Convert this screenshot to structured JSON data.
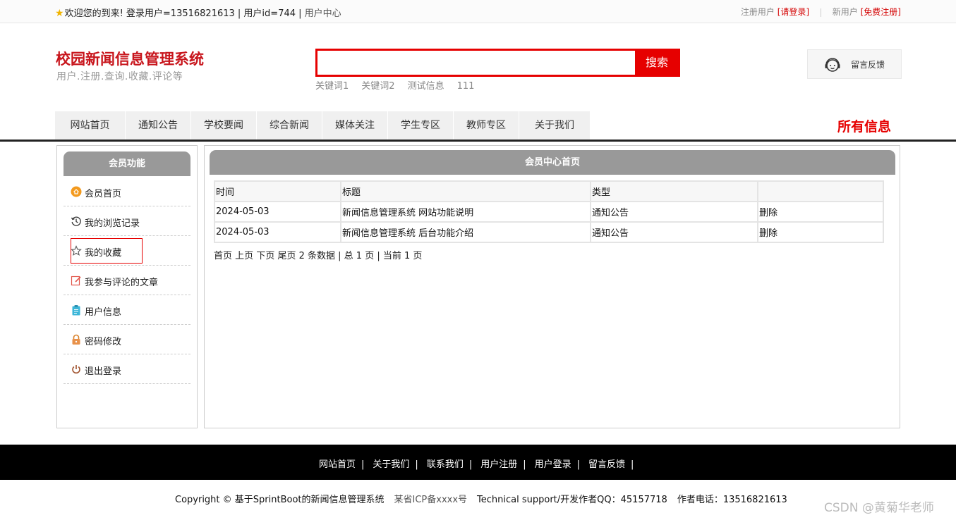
{
  "topbar": {
    "welcome": "欢迎您的到来!",
    "user_info": " 登录用户=13516821613 | 用户id=744 | ",
    "user_center": "用户中心",
    "reg_user_label": "注册用户",
    "login_link": "[请登录]",
    "new_user_label": "新用户",
    "register_link": "[免费注册]"
  },
  "header": {
    "site_title": "校园新闻信息管理系统",
    "site_subtitle": "用户.注册.查询.收藏.评论等",
    "search_placeholder": "",
    "search_button": "搜索",
    "keywords": [
      "关键词1",
      "关键词2",
      "测试信息",
      "111"
    ],
    "feedback_label": "留言反馈"
  },
  "nav": {
    "items": [
      "网站首页",
      "通知公告",
      "学校要闻",
      "综合新闻",
      "媒体关注",
      "学生专区",
      "教师专区",
      "关于我们"
    ],
    "all_info": "所有信息"
  },
  "sidebar": {
    "title": "会员功能",
    "items": [
      {
        "label": "会员首页",
        "icon": "home-circle-icon"
      },
      {
        "label": "我的浏览记录",
        "icon": "history-icon"
      },
      {
        "label": "我的收藏",
        "icon": "star-outline-icon"
      },
      {
        "label": "我参与评论的文章",
        "icon": "edit-icon"
      },
      {
        "label": "用户信息",
        "icon": "clipboard-icon"
      },
      {
        "label": "密码修改",
        "icon": "lock-icon"
      },
      {
        "label": "退出登录",
        "icon": "power-icon"
      }
    ]
  },
  "main": {
    "title": "会员中心首页",
    "columns": [
      "时间",
      "标题",
      "类型",
      ""
    ],
    "rows": [
      {
        "time": "2024-05-03",
        "title": "新闻信息管理系统 网站功能说明",
        "type": "通知公告",
        "action": "删除"
      },
      {
        "time": "2024-05-03",
        "title": "新闻信息管理系统 后台功能介绍",
        "type": "通知公告",
        "action": "删除"
      }
    ],
    "pager": {
      "first": "首页",
      "prev": "上页",
      "next": "下页",
      "last": "尾页",
      "summary": "2 条数据 | 总 1 页 | 当前 1 页"
    }
  },
  "footer": {
    "links": [
      "网站首页",
      "关于我们",
      "联系我们",
      "用户注册",
      "用户登录",
      "留言反馈"
    ],
    "copyright": "Copyright © 基于SprintBoot的新闻信息管理系统",
    "icp": "某省ICP备xxxx号",
    "support": "Technical support/开发作者QQ：45157718",
    "phone": "作者电话：13516821613"
  },
  "watermark": "CSDN @黄菊华老师",
  "colors": {
    "brand_red": "#e60000",
    "title_red": "#c8161d",
    "panel_gray": "#999999"
  }
}
